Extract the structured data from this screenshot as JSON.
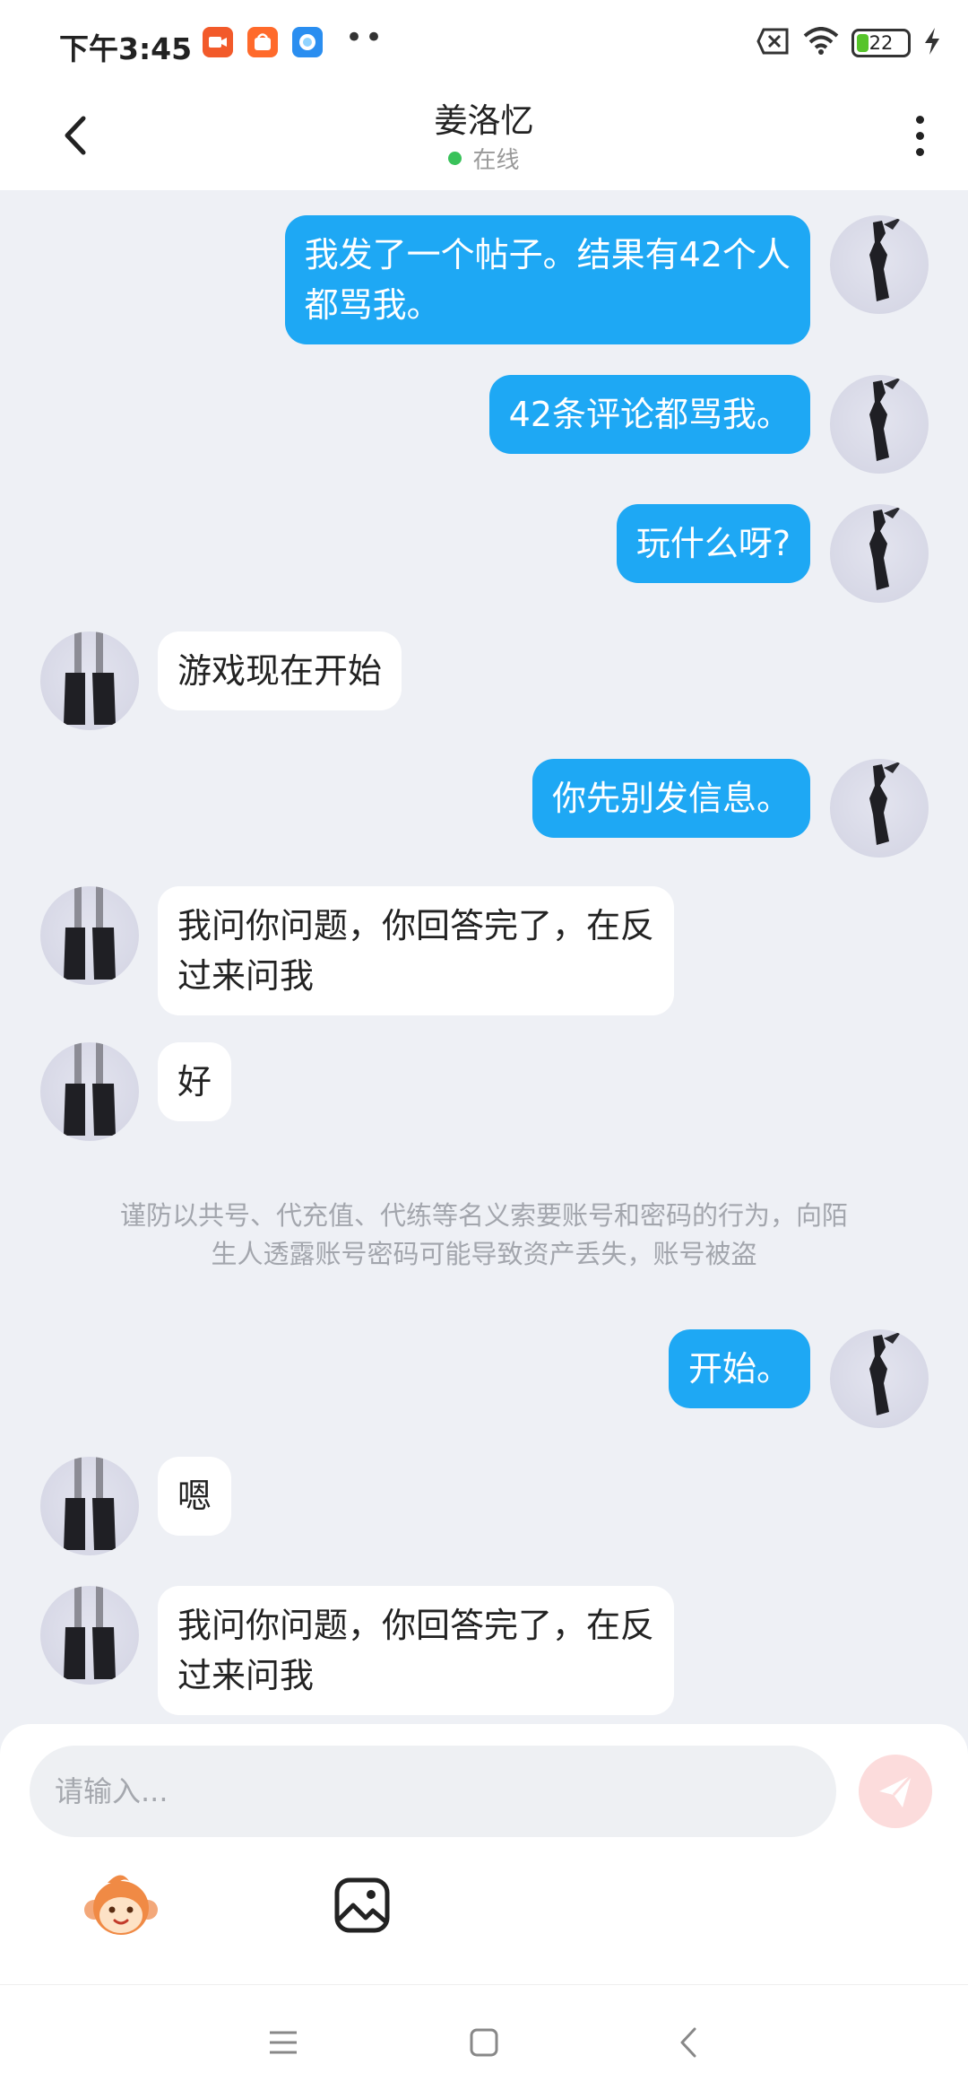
{
  "status_bar": {
    "time": "下午3:45",
    "dots": "••",
    "battery": "22",
    "app_icons": [
      "video-app-icon",
      "shopping-app-icon",
      "browser-app-icon"
    ]
  },
  "header": {
    "title": "姜洛忆",
    "status": "在线"
  },
  "messages": [
    {
      "from": "me",
      "lines": [
        "我发了一个帖子。结果有42个人",
        "都骂我。"
      ]
    },
    {
      "from": "me",
      "lines": [
        "42条评论都骂我。"
      ]
    },
    {
      "from": "me",
      "lines": [
        "玩什么呀?"
      ]
    },
    {
      "from": "other",
      "lines": [
        "游戏现在开始"
      ]
    },
    {
      "from": "me",
      "lines": [
        "你先别发信息。"
      ]
    },
    {
      "from": "other",
      "lines": [
        "我问你问题，你回答完了，在反",
        "过来问我"
      ]
    },
    {
      "from": "other",
      "lines": [
        "好"
      ]
    },
    {
      "from": "me",
      "lines": [
        "开始。"
      ]
    },
    {
      "from": "other",
      "lines": [
        "嗯"
      ]
    },
    {
      "from": "other",
      "lines": [
        "我问你问题，你回答完了，在反",
        "过来问我"
      ]
    }
  ],
  "notice": {
    "line1": "谨防以共号、代充值、代练等名义索要账号和密码的行为，向陌",
    "line2": "生人透露账号密码可能导致资产丢失，账号被盗"
  },
  "input": {
    "placeholder": "请输入..."
  },
  "colors": {
    "outgoing_bubble": "#1ea8f4",
    "incoming_bubble": "#ffffff",
    "background": "#eef0f5",
    "online_dot": "#39c25a",
    "send_button": "#fcdcdc"
  }
}
